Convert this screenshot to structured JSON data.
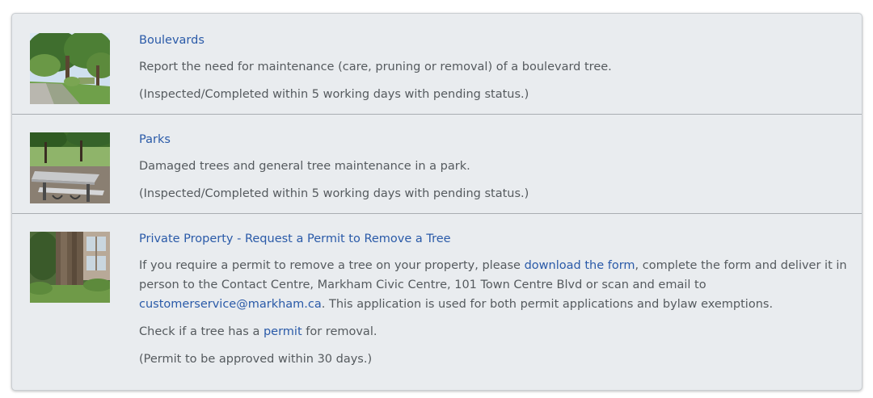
{
  "items": [
    {
      "title": "Boulevards",
      "description": "Report the need for maintenance (care, pruning or removal) of a boulevard tree.",
      "note": "(Inspected/Completed within 5 working days with pending status.)",
      "image_icon": "boulevard-tree-photo"
    },
    {
      "title": "Parks",
      "description": "Damaged trees and general tree maintenance in a park.",
      "note": "(Inspected/Completed within 5 working days with pending status.)",
      "image_icon": "park-picnic-table-photo"
    },
    {
      "title": "Private Property - Request a Permit to Remove a Tree",
      "desc_part1": "If you require a permit to remove a tree on your property, please ",
      "desc_link1": "download the form",
      "desc_part2": ", complete the form and deliver it in person to the Contact Centre, Markham Civic Centre, 101 Town Centre Blvd or scan and email to ",
      "desc_link2": "customerservice@markham.ca",
      "desc_part3": ". This application is used for both permit applications and bylaw exemptions.",
      "check_part1": "Check if a tree has a ",
      "check_link": "permit",
      "check_part2": " for removal.",
      "note": "(Permit to be approved within 30 days.)",
      "image_icon": "private-property-tree-photo"
    }
  ],
  "colors": {
    "link": "#2a5aa8",
    "text": "#555a5e",
    "panel_bg": "#e9ecef",
    "divider": "#a9adb1"
  }
}
